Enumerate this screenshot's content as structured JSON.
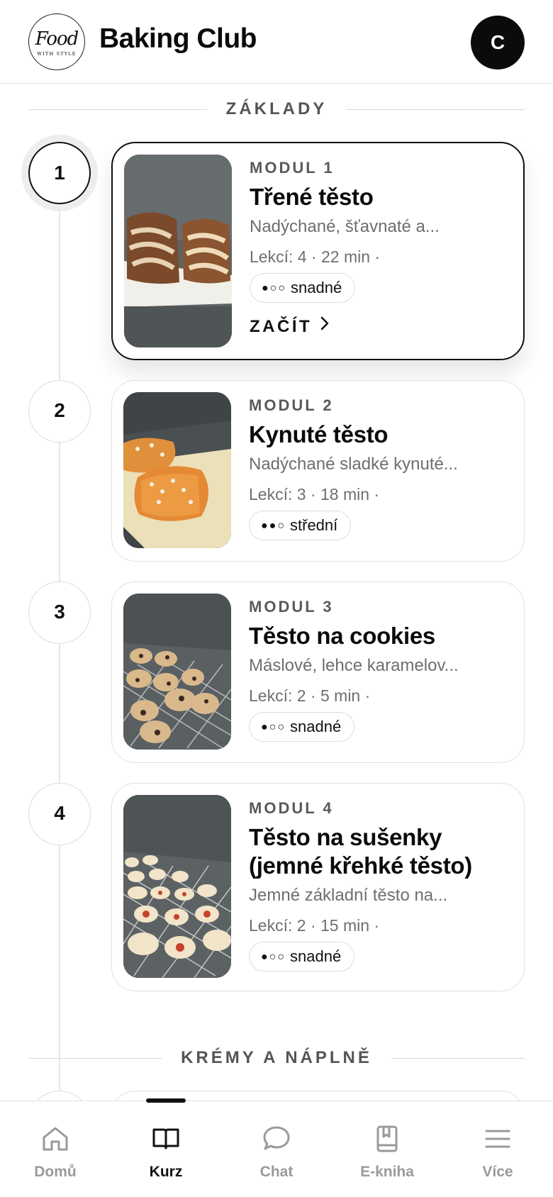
{
  "header": {
    "logo_main": "Food",
    "logo_sub": "WITH STYLE",
    "title": "Baking Club",
    "avatar_initial": "C"
  },
  "sections": [
    {
      "title": "ZÁKLADY"
    },
    {
      "title": "KRÉMY A NÁPLNĚ"
    }
  ],
  "modules": [
    {
      "number": "1",
      "label": "MODUL 1",
      "title": "Třené těsto",
      "description": "Nadýchané, šťavnaté a...",
      "meta": "Lekcí: 4 · 22 min ·",
      "difficulty_dots": "●○○",
      "difficulty": "snadné",
      "cta": "ZAČÍT",
      "active": true
    },
    {
      "number": "2",
      "label": "MODUL 2",
      "title": "Kynuté těsto",
      "description": "Nadýchané sladké kynuté...",
      "meta": "Lekcí: 3 · 18 min ·",
      "difficulty_dots": "●●○",
      "difficulty": "střední"
    },
    {
      "number": "3",
      "label": "MODUL 3",
      "title": "Těsto na cookies",
      "description": "Máslové, lehce karamelov...",
      "meta": "Lekcí: 2 · 5 min ·",
      "difficulty_dots": "●○○",
      "difficulty": "snadné"
    },
    {
      "number": "4",
      "label": "MODUL 4",
      "title": "Těsto na sušenky (jemné křehké těsto)",
      "description": "Jemné základní těsto na...",
      "meta": "Lekcí: 2 · 15 min ·",
      "difficulty_dots": "●○○",
      "difficulty": "snadné"
    }
  ],
  "nav": {
    "items": [
      {
        "label": "Domů",
        "icon": "home-icon"
      },
      {
        "label": "Kurz",
        "icon": "book-icon",
        "active": true
      },
      {
        "label": "Chat",
        "icon": "chat-bubble-icon"
      },
      {
        "label": "E-kniha",
        "icon": "ebook-icon"
      },
      {
        "label": "Více",
        "icon": "menu-icon"
      }
    ]
  },
  "colors": {
    "accent": "#0b0b0b",
    "muted_text": "#6e6e6e",
    "border": "#e1e1e1"
  }
}
